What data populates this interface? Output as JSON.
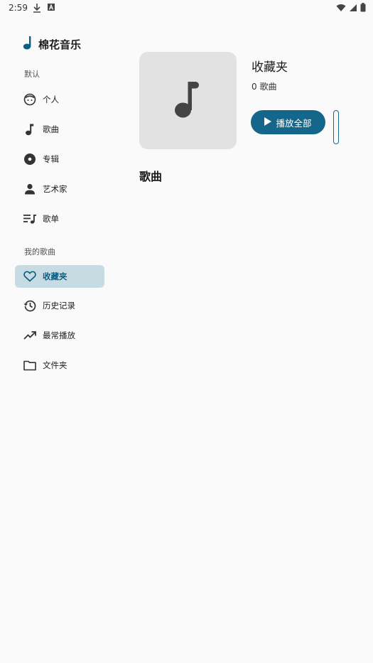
{
  "status_bar": {
    "time": "2:59",
    "icons": [
      "download-icon",
      "a-icon",
      "wifi-icon",
      "signal-icon",
      "battery-icon"
    ]
  },
  "app": {
    "title": "棉花音乐",
    "logo_icon": "music-note-icon",
    "accent_color": "#14678a"
  },
  "sidebar": {
    "section_default": "默认",
    "default_items": [
      {
        "label": "个人",
        "icon": "face-icon"
      },
      {
        "label": "歌曲",
        "icon": "music-note-icon"
      },
      {
        "label": "专辑",
        "icon": "album-icon"
      },
      {
        "label": "艺术家",
        "icon": "person-icon"
      },
      {
        "label": "歌单",
        "icon": "queue-music-icon"
      }
    ],
    "section_my": "我的歌曲",
    "my_items": [
      {
        "label": "收藏夹",
        "icon": "heart-icon",
        "active": true
      },
      {
        "label": "历史记录",
        "icon": "history-icon"
      },
      {
        "label": "最常播放",
        "icon": "trending-up-icon"
      },
      {
        "label": "文件夹",
        "icon": "folder-icon"
      }
    ]
  },
  "main": {
    "playlist_title": "收藏夹",
    "song_count": "0 歌曲",
    "play_all_label": "播放全部",
    "songs_heading": "歌曲"
  }
}
